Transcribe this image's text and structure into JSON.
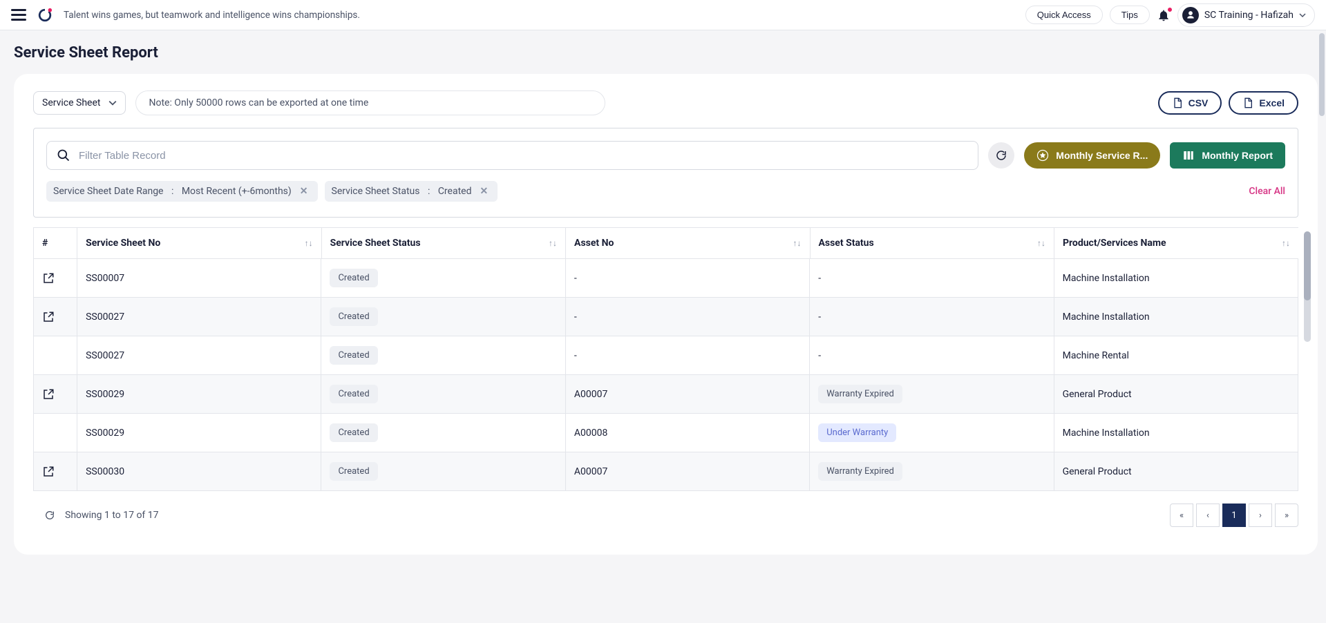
{
  "header": {
    "tagline": "Talent wins games, but teamwork and intelligence wins championships.",
    "quick_access": "Quick Access",
    "tips": "Tips",
    "user_label": "SC Training - Hafizah"
  },
  "page": {
    "title": "Service Sheet Report"
  },
  "toolbar": {
    "dropdown_label": "Service Sheet",
    "note": "Note: Only 50000 rows can be exported at one time",
    "csv_label": "CSV",
    "excel_label": "Excel"
  },
  "search": {
    "placeholder": "Filter Table Record",
    "monthly_service_label": "Monthly Service R...",
    "monthly_report_label": "Monthly Report"
  },
  "filters": {
    "chip1_label": "Service Sheet Date Range",
    "chip1_value": "Most Recent (+-6months)",
    "chip2_label": "Service Sheet Status",
    "chip2_value": "Created",
    "clear_all": "Clear All"
  },
  "columns": {
    "hash": "#",
    "sheet_no": "Service Sheet No",
    "sheet_status": "Service Sheet Status",
    "asset_no": "Asset No",
    "asset_status": "Asset Status",
    "product": "Product/Services Name"
  },
  "rows": [
    {
      "openable": true,
      "sheet_no": "SS00007",
      "status": "Created",
      "asset_no": "-",
      "asset_status": "-",
      "asset_badge": "plain",
      "product": "Machine Installation"
    },
    {
      "openable": true,
      "sheet_no": "SS00027",
      "status": "Created",
      "asset_no": "-",
      "asset_status": "-",
      "asset_badge": "plain",
      "product": "Machine Installation"
    },
    {
      "openable": false,
      "sheet_no": "SS00027",
      "status": "Created",
      "asset_no": "-",
      "asset_status": "-",
      "asset_badge": "plain",
      "product": "Machine Rental"
    },
    {
      "openable": true,
      "sheet_no": "SS00029",
      "status": "Created",
      "asset_no": "A00007",
      "asset_status": "Warranty Expired",
      "asset_badge": "gray",
      "product": "General Product"
    },
    {
      "openable": false,
      "sheet_no": "SS00029",
      "status": "Created",
      "asset_no": "A00008",
      "asset_status": "Under Warranty",
      "asset_badge": "blue",
      "product": "Machine Installation"
    },
    {
      "openable": true,
      "sheet_no": "SS00030",
      "status": "Created",
      "asset_no": "A00007",
      "asset_status": "Warranty Expired",
      "asset_badge": "gray",
      "product": "General Product"
    }
  ],
  "pager": {
    "info": "Showing 1 to 17 of 17",
    "current_page": "1"
  }
}
